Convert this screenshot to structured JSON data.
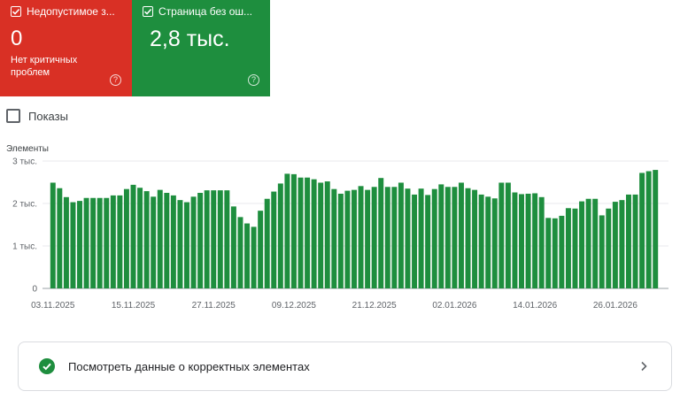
{
  "cards": [
    {
      "title": "Недопустимое з...",
      "value": "0",
      "subtitle": "Нет критичных проблем",
      "help": "?",
      "color": "#d93025"
    },
    {
      "title": "Страница без ош...",
      "value": "2,8 тыс.",
      "subtitle": "",
      "help": "?",
      "color": "#1e8e3e"
    }
  ],
  "impressions": {
    "label": "Показы",
    "checked": false
  },
  "chart_data": {
    "type": "bar",
    "ylabel": "Элементы",
    "y_ticks": [
      "0",
      "1 тыс.",
      "2 тыс.",
      "3 тыс."
    ],
    "x_ticks": [
      "03.11.2025",
      "15.11.2025",
      "27.11.2025",
      "09.12.2025",
      "21.12.2025",
      "02.01.2026",
      "14.01.2026",
      "26.01.2026"
    ],
    "ylim": [
      0,
      3000
    ],
    "grid": true,
    "color": "#1e8e3e",
    "start_date": "03.11.2025",
    "values": [
      2490,
      2360,
      2150,
      2030,
      2060,
      2130,
      2130,
      2130,
      2130,
      2190,
      2190,
      2340,
      2440,
      2370,
      2290,
      2160,
      2320,
      2250,
      2190,
      2080,
      2030,
      2160,
      2250,
      2310,
      2310,
      2310,
      2310,
      1930,
      1680,
      1530,
      1450,
      1830,
      2110,
      2280,
      2470,
      2700,
      2690,
      2610,
      2610,
      2570,
      2490,
      2520,
      2340,
      2230,
      2300,
      2320,
      2410,
      2320,
      2390,
      2600,
      2390,
      2390,
      2490,
      2350,
      2210,
      2350,
      2200,
      2340,
      2450,
      2390,
      2390,
      2490,
      2360,
      2320,
      2210,
      2160,
      2120,
      2490,
      2490,
      2260,
      2220,
      2230,
      2240,
      2150,
      1660,
      1650,
      1710,
      1890,
      1880,
      2050,
      2110,
      2110,
      1720,
      1880,
      2040,
      2080,
      2210,
      2210,
      2720,
      2760,
      2790
    ]
  },
  "ok_row": {
    "label": "Посмотреть данные о корректных элементах",
    "icon": "check-circle-icon"
  }
}
